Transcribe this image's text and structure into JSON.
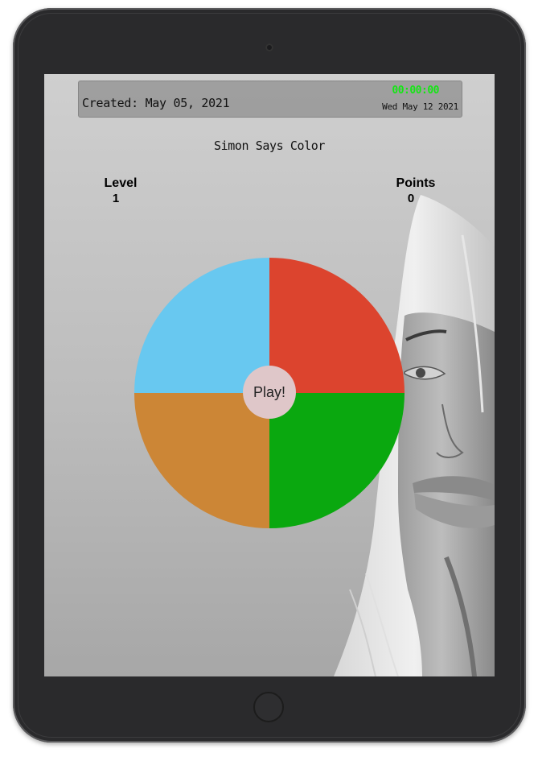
{
  "header": {
    "created_text": "Created: May 05, 2021",
    "clock_text": "00:00:00",
    "date_text": "Wed May 12 2021"
  },
  "game": {
    "title": "Simon Says Color",
    "level_label": "Level",
    "level_value": "1",
    "points_label": "Points",
    "points_value": "0",
    "play_label": "Play!"
  },
  "colors": {
    "blue": "#68c8f0",
    "red": "#dc442e",
    "orange": "#cc8636",
    "green": "#0aa80f",
    "play_button": "#dfc7c9",
    "clock": "#14e614"
  }
}
